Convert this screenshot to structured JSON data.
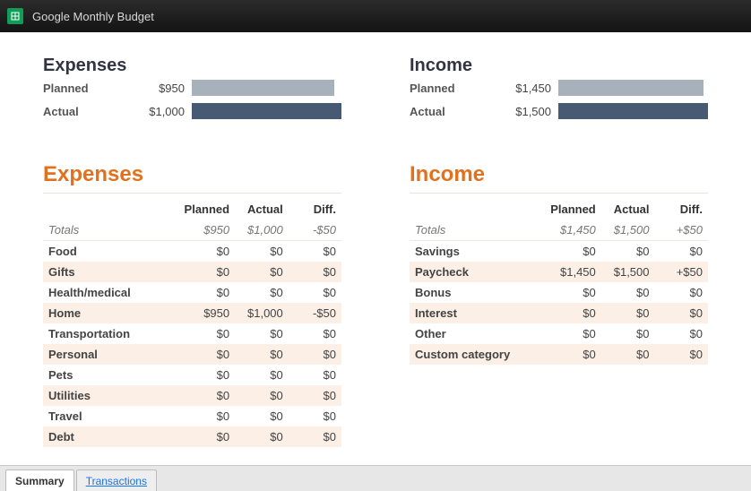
{
  "title": "Google Monthly Budget",
  "expenses_overview": {
    "title": "Expenses",
    "planned_label": "Planned",
    "planned_value": "$950",
    "planned_bar_pct": 95,
    "actual_label": "Actual",
    "actual_value": "$1,000",
    "actual_bar_pct": 100
  },
  "income_overview": {
    "title": "Income",
    "planned_label": "Planned",
    "planned_value": "$1,450",
    "planned_bar_pct": 97,
    "actual_label": "Actual",
    "actual_value": "$1,500",
    "actual_bar_pct": 100
  },
  "expenses_table": {
    "title": "Expenses",
    "headers": {
      "planned": "Planned",
      "actual": "Actual",
      "diff": "Diff."
    },
    "totals_label": "Totals",
    "totals": {
      "planned": "$950",
      "actual": "$1,000",
      "diff": "-$50",
      "diff_sign": "neg"
    },
    "rows": [
      {
        "name": "Food",
        "planned": "$0",
        "actual": "$0",
        "diff": "$0",
        "diff_sign": "zero"
      },
      {
        "name": "Gifts",
        "planned": "$0",
        "actual": "$0",
        "diff": "$0",
        "diff_sign": "zero"
      },
      {
        "name": "Health/medical",
        "planned": "$0",
        "actual": "$0",
        "diff": "$0",
        "diff_sign": "zero"
      },
      {
        "name": "Home",
        "planned": "$950",
        "actual": "$1,000",
        "diff": "-$50",
        "diff_sign": "neg"
      },
      {
        "name": "Transportation",
        "planned": "$0",
        "actual": "$0",
        "diff": "$0",
        "diff_sign": "zero"
      },
      {
        "name": "Personal",
        "planned": "$0",
        "actual": "$0",
        "diff": "$0",
        "diff_sign": "zero"
      },
      {
        "name": "Pets",
        "planned": "$0",
        "actual": "$0",
        "diff": "$0",
        "diff_sign": "zero"
      },
      {
        "name": "Utilities",
        "planned": "$0",
        "actual": "$0",
        "diff": "$0",
        "diff_sign": "zero"
      },
      {
        "name": "Travel",
        "planned": "$0",
        "actual": "$0",
        "diff": "$0",
        "diff_sign": "zero"
      },
      {
        "name": "Debt",
        "planned": "$0",
        "actual": "$0",
        "diff": "$0",
        "diff_sign": "zero"
      }
    ]
  },
  "income_table": {
    "title": "Income",
    "headers": {
      "planned": "Planned",
      "actual": "Actual",
      "diff": "Diff."
    },
    "totals_label": "Totals",
    "totals": {
      "planned": "$1,450",
      "actual": "$1,500",
      "diff": "+$50",
      "diff_sign": "pos"
    },
    "rows": [
      {
        "name": "Savings",
        "planned": "$0",
        "actual": "$0",
        "diff": "$0",
        "diff_sign": "zero"
      },
      {
        "name": "Paycheck",
        "planned": "$1,450",
        "actual": "$1,500",
        "diff": "+$50",
        "diff_sign": "pos"
      },
      {
        "name": "Bonus",
        "planned": "$0",
        "actual": "$0",
        "diff": "$0",
        "diff_sign": "zero"
      },
      {
        "name": "Interest",
        "planned": "$0",
        "actual": "$0",
        "diff": "$0",
        "diff_sign": "zero"
      },
      {
        "name": "Other",
        "planned": "$0",
        "actual": "$0",
        "diff": "$0",
        "diff_sign": "zero"
      },
      {
        "name": "Custom category",
        "planned": "$0",
        "actual": "$0",
        "diff": "$0",
        "diff_sign": "zero"
      }
    ]
  },
  "tabs": {
    "summary": "Summary",
    "transactions": "Transactions"
  }
}
